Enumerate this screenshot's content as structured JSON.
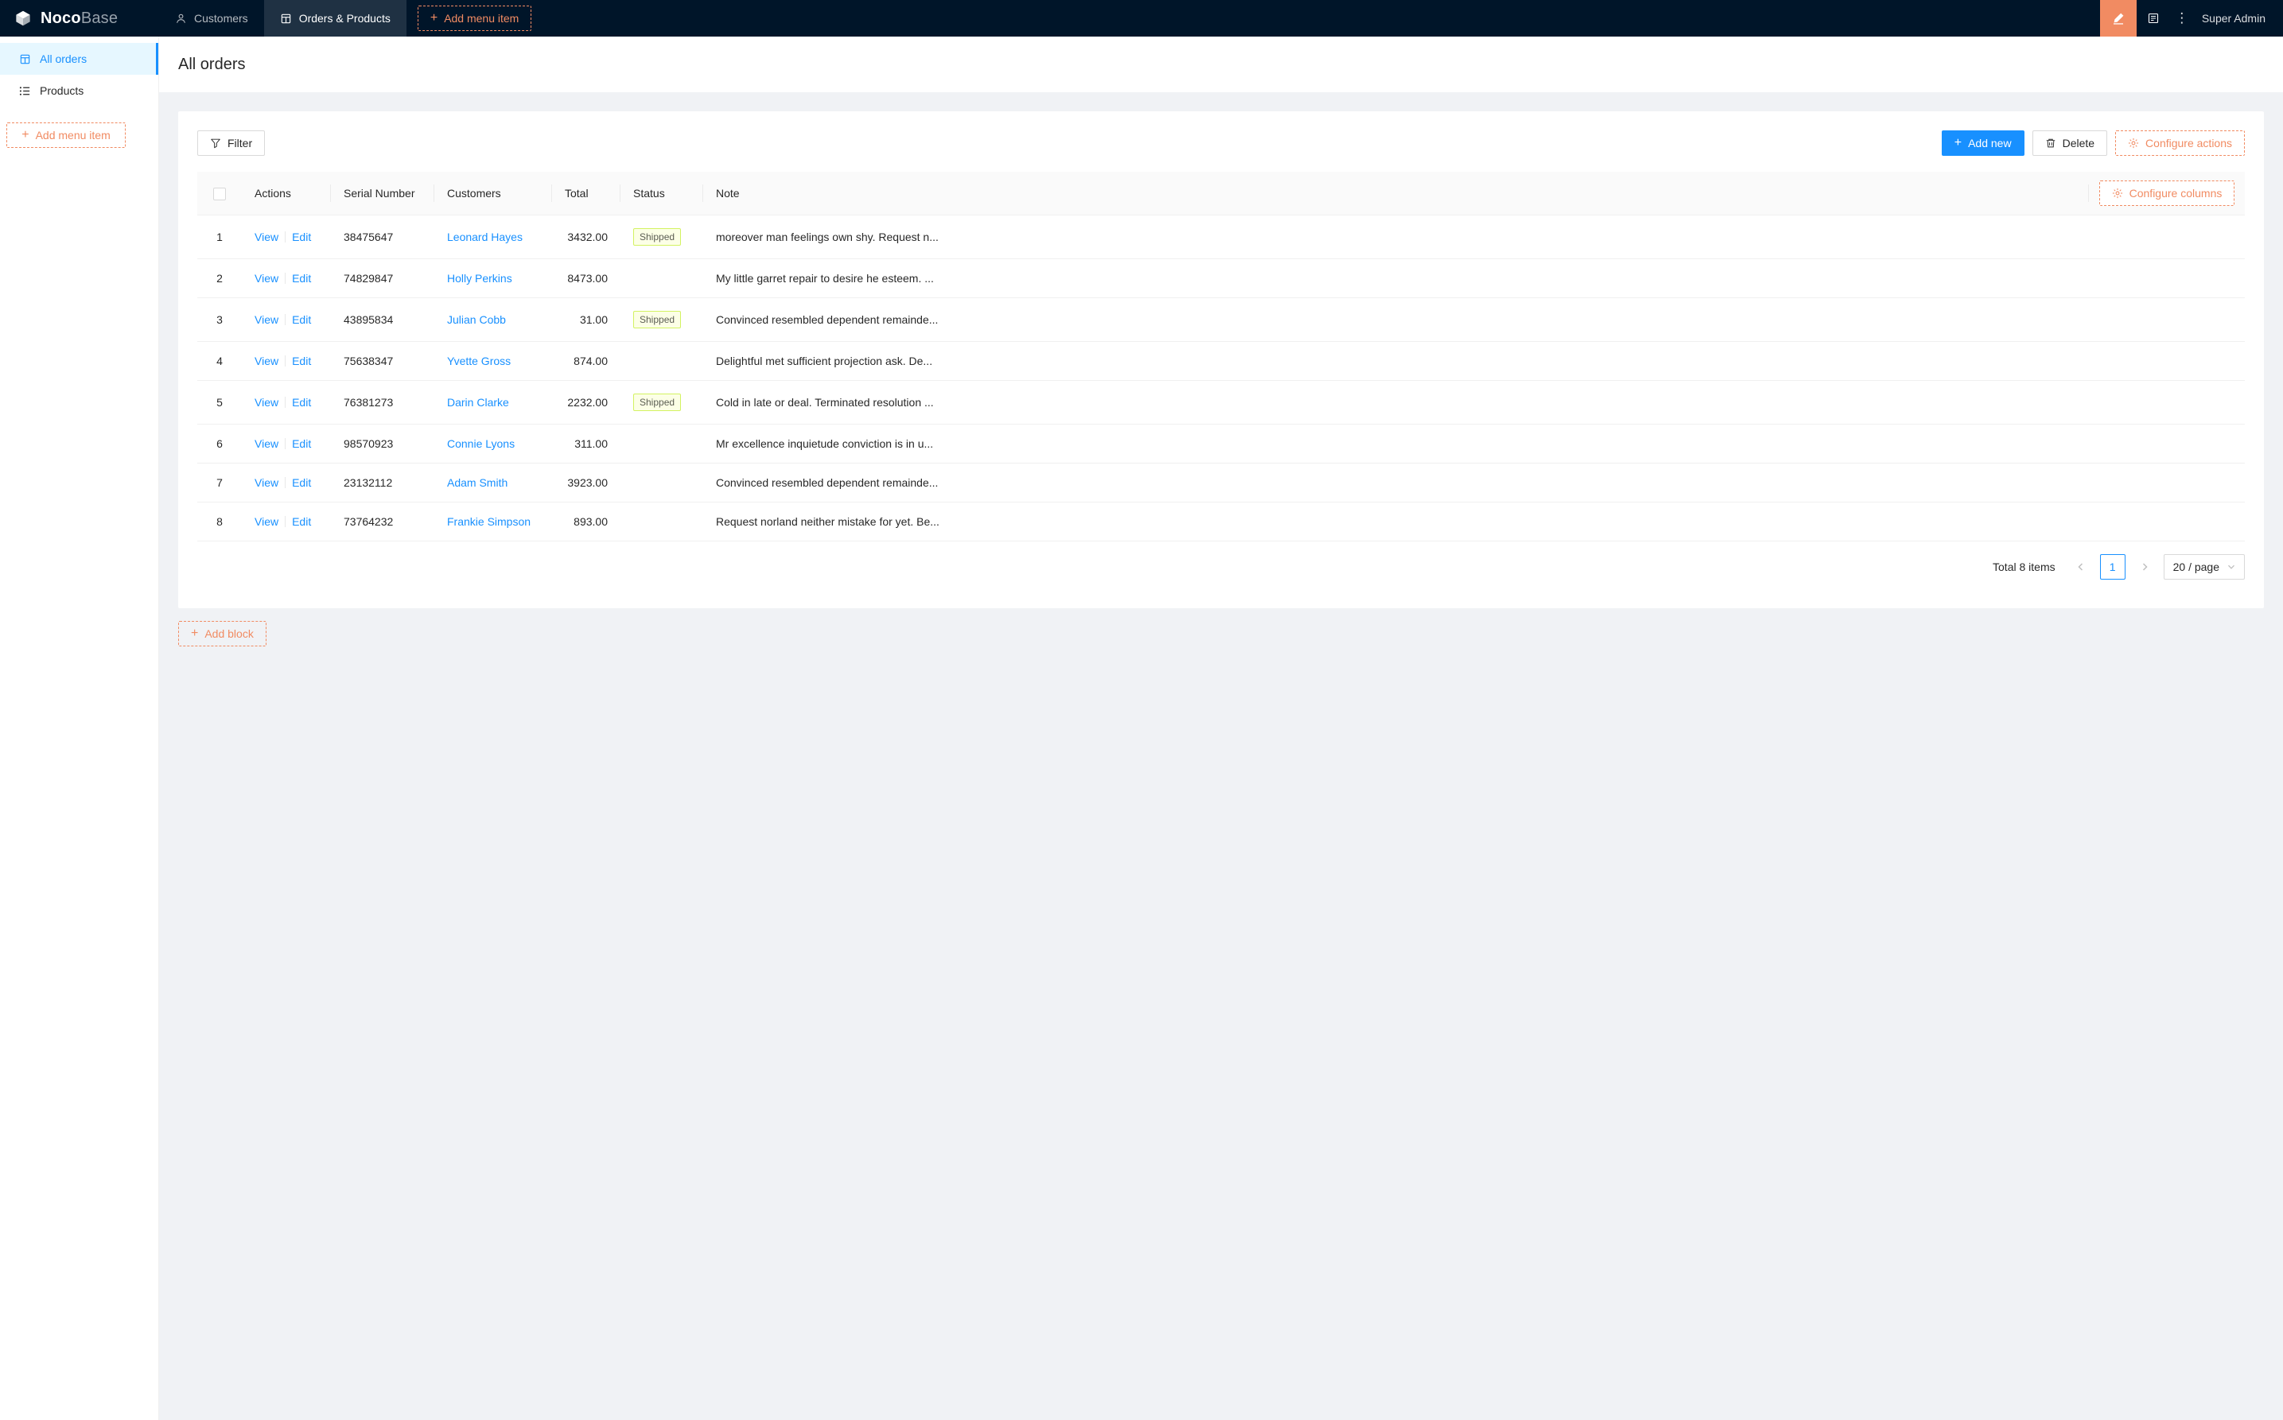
{
  "navbar": {
    "logo_primary": "Noco",
    "logo_secondary": "Base",
    "items": [
      {
        "label": "Customers"
      },
      {
        "label": "Orders & Products"
      }
    ],
    "add_menu_item_label": "Add menu item",
    "user": "Super Admin"
  },
  "sidebar": {
    "items": [
      {
        "label": "All orders"
      },
      {
        "label": "Products"
      }
    ],
    "add_menu_item_label": "Add menu item"
  },
  "page": {
    "title": "All orders"
  },
  "toolbar": {
    "filter_label": "Filter",
    "add_new_label": "Add new",
    "delete_label": "Delete",
    "configure_actions_label": "Configure actions"
  },
  "table": {
    "columns": [
      "Actions",
      "Serial Number",
      "Customers",
      "Total",
      "Status",
      "Note"
    ],
    "configure_columns_label": "Configure columns",
    "action_links": {
      "view": "View",
      "edit": "Edit"
    },
    "rows": [
      {
        "index": 1,
        "serial": "38475647",
        "customer": "Leonard Hayes",
        "total": "3432.00",
        "status": "Shipped",
        "note": "moreover man feelings own shy. Request n..."
      },
      {
        "index": 2,
        "serial": "74829847",
        "customer": "Holly Perkins",
        "total": "8473.00",
        "status": "",
        "note": "My little garret repair to desire he esteem. ..."
      },
      {
        "index": 3,
        "serial": "43895834",
        "customer": "Julian Cobb",
        "total": "31.00",
        "status": "Shipped",
        "note": "Convinced resembled dependent remainde..."
      },
      {
        "index": 4,
        "serial": "75638347",
        "customer": "Yvette Gross",
        "total": "874.00",
        "status": "",
        "note": "Delightful met sufficient projection ask. De..."
      },
      {
        "index": 5,
        "serial": "76381273",
        "customer": "Darin Clarke",
        "total": "2232.00",
        "status": "Shipped",
        "note": "Cold in late or deal. Terminated resolution ..."
      },
      {
        "index": 6,
        "serial": "98570923",
        "customer": "Connie Lyons",
        "total": "311.00",
        "status": "",
        "note": "Mr excellence inquietude conviction is in u..."
      },
      {
        "index": 7,
        "serial": "23132112",
        "customer": "Adam Smith",
        "total": "3923.00",
        "status": "",
        "note": "Convinced resembled dependent remainde..."
      },
      {
        "index": 8,
        "serial": "73764232",
        "customer": "Frankie Simpson",
        "total": "893.00",
        "status": "",
        "note": "Request norland neither mistake for yet. Be..."
      }
    ]
  },
  "pagination": {
    "total_text": "Total 8 items",
    "current_page": "1",
    "page_size": "20 / page"
  },
  "footer": {
    "add_block_label": "Add block"
  },
  "icons": {
    "plus": "+",
    "more": "⋮"
  },
  "colors": {
    "accent_orange": "#f18b62",
    "primary_blue": "#1890ff",
    "navbar_bg": "#001529",
    "page_bg": "#f0f2f5",
    "sidebar_active_bg": "#e6f7ff",
    "status_shipped_bg": "#fcffe6",
    "status_shipped_border": "#d3f261"
  }
}
